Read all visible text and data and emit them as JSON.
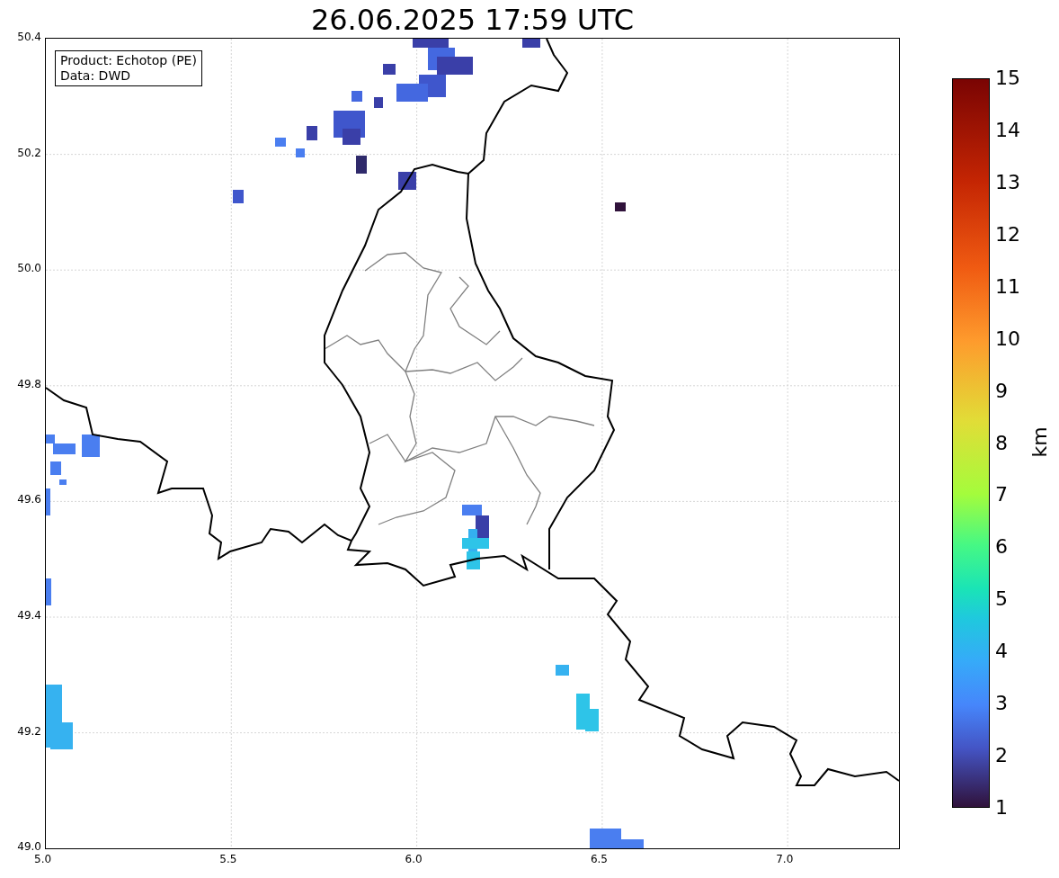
{
  "title": "26.06.2025 17:59 UTC",
  "legend": [
    "Product: Echotop (PE)",
    "Data: DWD"
  ],
  "x_axis": {
    "ticks": [
      "5.0",
      "5.5",
      "6.0",
      "6.5",
      "7.0"
    ]
  },
  "y_axis": {
    "ticks": [
      "50.4",
      "50.2",
      "50.0",
      "49.8",
      "49.6",
      "49.4",
      "49.2",
      "49.0"
    ]
  },
  "colorbar": {
    "label": "km",
    "ticks": [
      "15",
      "14",
      "13",
      "12",
      "11",
      "10",
      "9",
      "8",
      "7",
      "6",
      "5",
      "4",
      "3",
      "2",
      "1"
    ]
  }
}
